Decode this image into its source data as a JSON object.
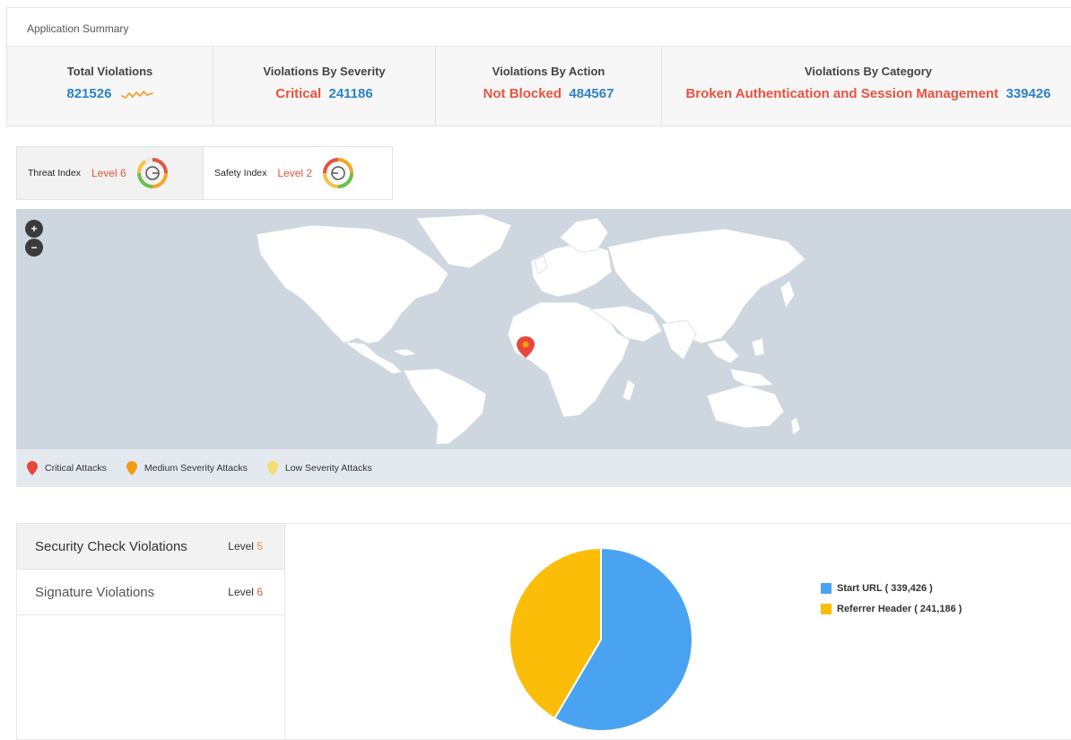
{
  "summary": {
    "title": "Application Summary",
    "stats": [
      {
        "label": "Total Violations",
        "value": "821526"
      },
      {
        "label": "Violations By Severity",
        "prefix": "Critical",
        "value": "241186"
      },
      {
        "label": "Violations By Action",
        "prefix": "Not Blocked",
        "value": "484567"
      },
      {
        "label": "Violations By Category",
        "prefix": "Broken Authentication and Session Management",
        "value": "339426"
      }
    ]
  },
  "indices": {
    "threat": {
      "label": "Threat Index",
      "level": "Level 6"
    },
    "safety": {
      "label": "Safety Index",
      "level": "Level 2"
    }
  },
  "map": {
    "zoom_in": "+",
    "zoom_out": "−",
    "legend": [
      {
        "label": "Critical Attacks",
        "color": "#e8473b"
      },
      {
        "label": "Medium Severity Attacks",
        "color": "#f39c12"
      },
      {
        "label": "Low Severity Attacks",
        "color": "#f7dc6f"
      }
    ]
  },
  "violations": {
    "items": [
      {
        "label": "Security Check Violations",
        "level_prefix": "Level ",
        "level_num": "5"
      },
      {
        "label": "Signature Violations",
        "level_prefix": "Level ",
        "level_num": "6"
      }
    ]
  },
  "colors": {
    "accent_red": "#e8533d",
    "accent_blue": "#2c83c7",
    "pie_blue": "#4aa3f0",
    "pie_yellow": "#fbbd08"
  },
  "chart_data": {
    "type": "pie",
    "series": [
      {
        "name": "Start URL ( 339,426 )",
        "value": 339426,
        "color": "#4aa3f0"
      },
      {
        "name": "Referrer Header ( 241,186 )",
        "value": 241186,
        "color": "#fbbd08"
      }
    ],
    "legend_position": "right"
  }
}
